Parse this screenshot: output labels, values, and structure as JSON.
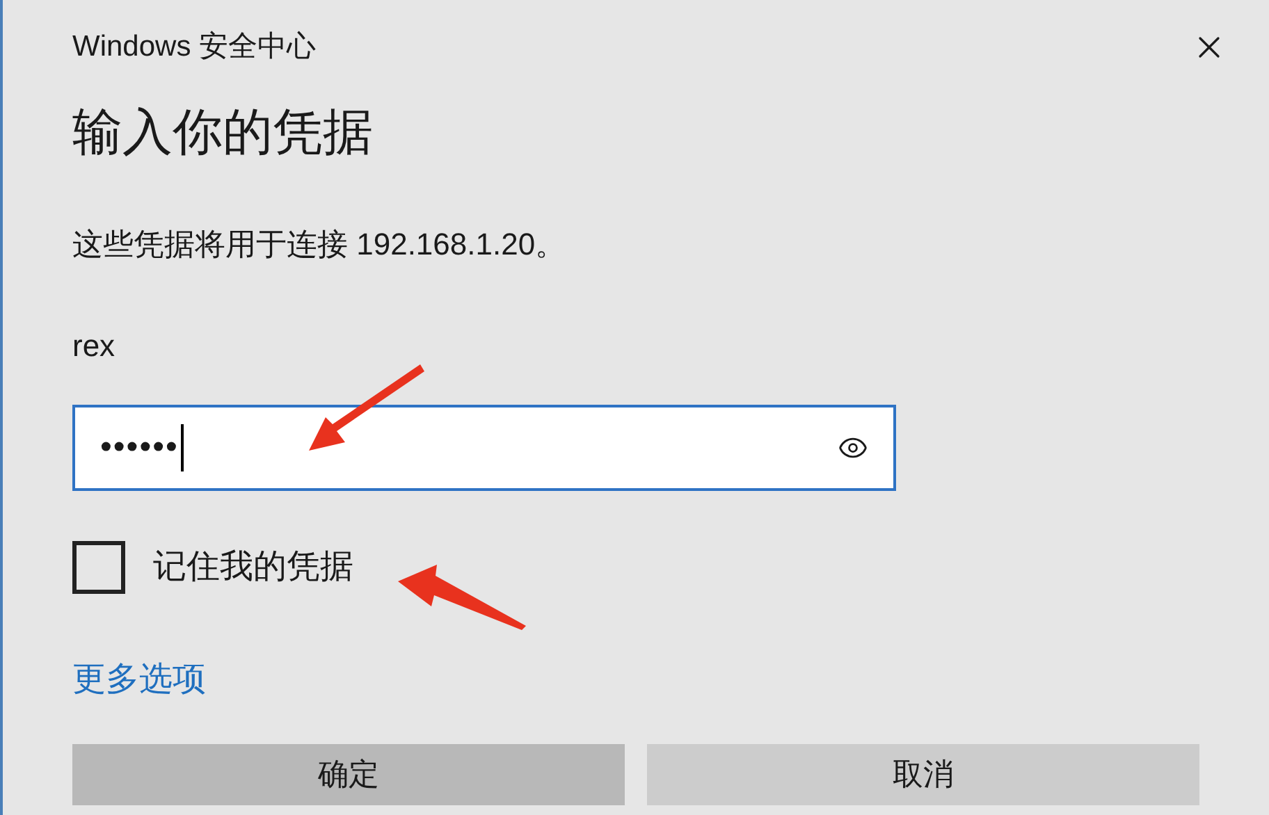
{
  "window": {
    "title": "Windows 安全中心"
  },
  "heading": "输入你的凭据",
  "description": "这些凭据将用于连接 192.168.1.20。",
  "username": "rex",
  "password": {
    "value": "••••••",
    "focused": true
  },
  "remember": {
    "label": "记住我的凭据",
    "checked": false
  },
  "more_options": "更多选项",
  "buttons": [
    {
      "label": "确定",
      "kind": "primary"
    },
    {
      "label": "取消",
      "kind": "secondary"
    }
  ]
}
